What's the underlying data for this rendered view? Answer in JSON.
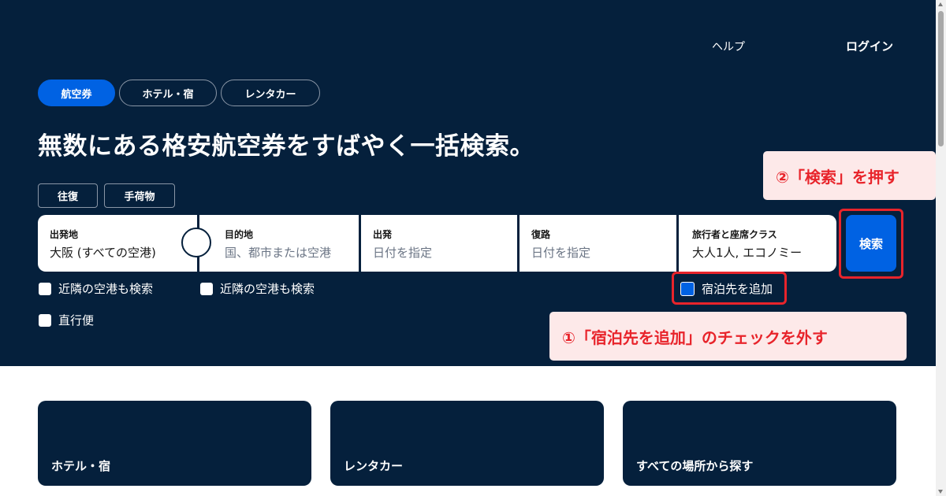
{
  "header": {
    "help": "ヘルプ",
    "login": "ログイン"
  },
  "tabs": [
    {
      "label": "航空券",
      "active": true
    },
    {
      "label": "ホテル・宿",
      "active": false
    },
    {
      "label": "レンタカー",
      "active": false
    }
  ],
  "headline": "無数にある格安航空券をすばやく一括検索。",
  "chips": {
    "trip_type": "往復",
    "baggage": "手荷物"
  },
  "search_form": {
    "origin": {
      "label": "出発地",
      "value": "大阪 (すべての空港)"
    },
    "destination": {
      "label": "目的地",
      "placeholder": "国、都市または空港"
    },
    "depart": {
      "label": "出発",
      "placeholder": "日付を指定"
    },
    "return": {
      "label": "復路",
      "placeholder": "日付を指定"
    },
    "travellers": {
      "label": "旅行者と座席クラス",
      "value": "大人1人, エコノミー"
    },
    "search_button": "検索"
  },
  "checkboxes": {
    "nearby_origin": "近隣の空港も検索",
    "nearby_dest": "近隣の空港も検索",
    "direct": "直行便",
    "add_hotel": "宿泊先を追加"
  },
  "callouts": {
    "step1": "①「宿泊先を追加」のチェックを外す",
    "step2": "②「検索」を押す"
  },
  "cards": [
    "ホテル・宿",
    "レンタカー",
    "すべての場所から探す"
  ],
  "colors": {
    "navy": "#05203c",
    "blue": "#0062e3",
    "annotation_red": "#e8242b",
    "annotation_bg": "#fde9e9"
  }
}
